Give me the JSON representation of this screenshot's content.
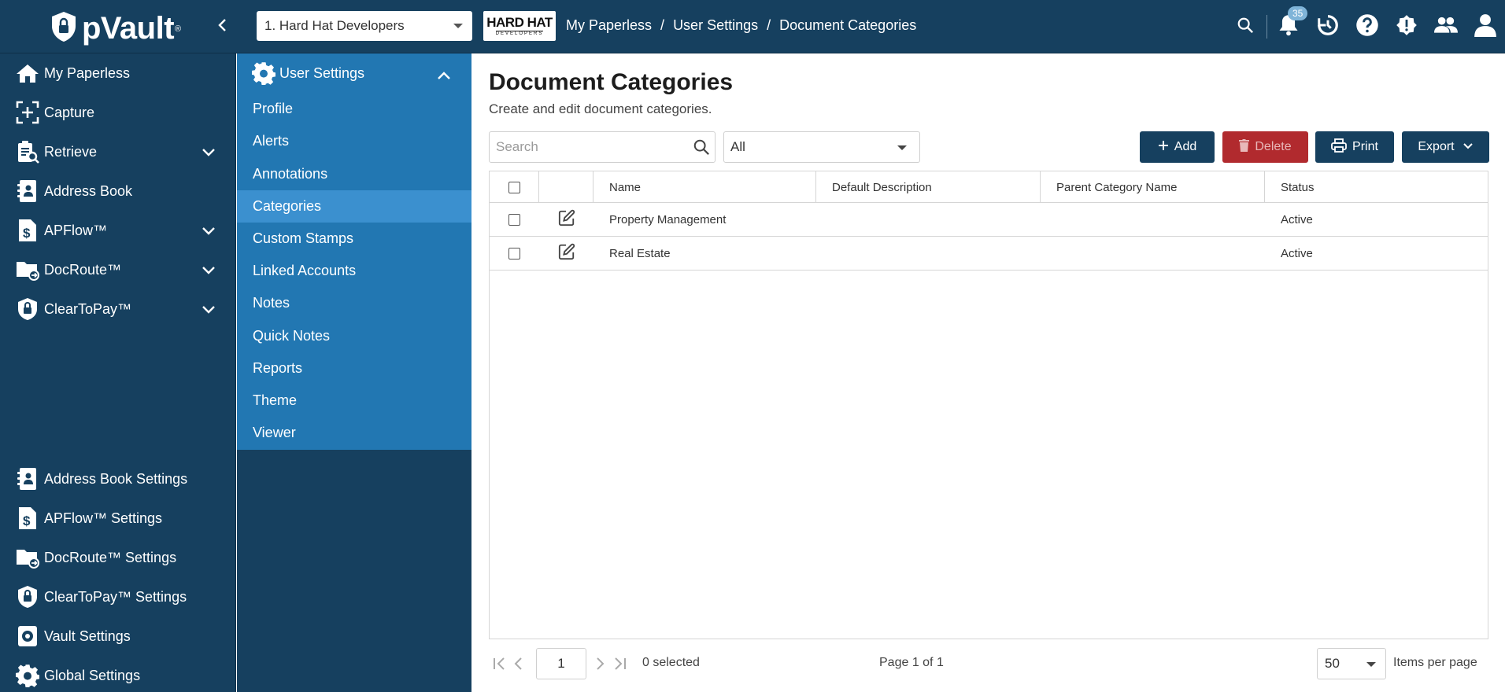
{
  "app": {
    "brand": "pVault",
    "brand_reg": "®"
  },
  "topbar": {
    "company_select": "1. Hard Hat Developers",
    "company_logo_main": "HARD HAT",
    "company_logo_sub": "DEVELOPERS",
    "breadcrumb": [
      "My Paperless",
      "User Settings",
      "Document Categories"
    ],
    "notification_count": "35"
  },
  "sidebar": {
    "top_items": [
      {
        "label": "My Paperless",
        "icon": "home-icon"
      },
      {
        "label": "Capture",
        "icon": "capture-icon"
      },
      {
        "label": "Retrieve",
        "icon": "retrieve-icon"
      },
      {
        "label": "Address Book",
        "icon": "address-book-icon"
      },
      {
        "label": "APFlow™",
        "icon": "apflow-icon"
      },
      {
        "label": "DocRoute™",
        "icon": "docroute-icon"
      },
      {
        "label": "ClearToPay™",
        "icon": "cleartopay-icon"
      }
    ],
    "bottom_items": [
      {
        "label": "Address Book Settings",
        "icon": "address-book-icon"
      },
      {
        "label": "APFlow™ Settings",
        "icon": "apflow-icon"
      },
      {
        "label": "DocRoute™ Settings",
        "icon": "docroute-icon"
      },
      {
        "label": "ClearToPay™ Settings",
        "icon": "cleartopay-icon"
      },
      {
        "label": "Vault Settings",
        "icon": "gear-icon"
      },
      {
        "label": "Global Settings",
        "icon": "gear-icon"
      }
    ]
  },
  "submenu": {
    "header": "User Settings",
    "items": [
      "Profile",
      "Alerts",
      "Annotations",
      "Categories",
      "Custom Stamps",
      "Linked Accounts",
      "Notes",
      "Quick Notes",
      "Reports",
      "Theme",
      "Viewer"
    ],
    "active": "Categories"
  },
  "main": {
    "title": "Document Categories",
    "subtitle": "Create and edit document categories.",
    "search_placeholder": "Search",
    "filter_value": "All",
    "buttons": {
      "add": "Add",
      "delete": "Delete",
      "print": "Print",
      "export": "Export"
    },
    "table": {
      "columns": [
        "Name",
        "Default Description",
        "Parent Category Name",
        "Status"
      ],
      "rows": [
        {
          "name": "Property Management",
          "default_description": "",
          "parent_category_name": "",
          "status": "Active"
        },
        {
          "name": "Real Estate",
          "default_description": "",
          "parent_category_name": "",
          "status": "Active"
        }
      ]
    },
    "pager": {
      "page": "1",
      "selected": "0 selected",
      "page_of": "Page 1 of 1",
      "per_page": "50",
      "per_page_label": "Items per page"
    }
  },
  "colors": {
    "navy": "#16405f",
    "submenu_blue": "#2277b2",
    "active_blue": "#3b90cf",
    "delete_red": "#b12a2e"
  }
}
